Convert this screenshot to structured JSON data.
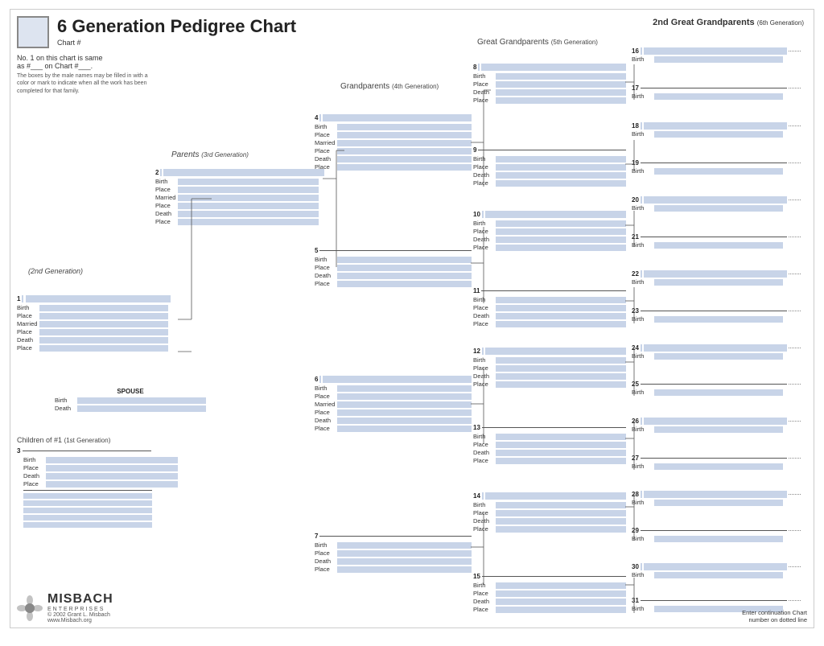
{
  "header": {
    "title": "6 Generation Pedigree Chart",
    "chart_num_label": "Chart #",
    "no1_text": "No. 1 on this chart is same",
    "no1_text2": "as #___ on Chart #___.",
    "instructions": "The boxes by the male names may be filled in with a color or mark to indicate when all the work has been completed for that family.",
    "gen2_label": "2nd Great Grandparents",
    "gen2_sub": "(6th Generation)",
    "great_label": "Great Grandparents",
    "great_sub": "(5th Generation)",
    "grand_label": "Grandparents",
    "grand_sub": "(4th Generation)",
    "parents_label": "Parents",
    "parents_sub": "(3rd Generation)",
    "gen2nd_label": "(2nd Generation)"
  },
  "fields": {
    "birth": "Birth",
    "place": "Place",
    "married": "Married",
    "death": "Death",
    "spouse": "SPOUSE",
    "children_label": "Children of #1",
    "children_sub": "(1st Generation)"
  },
  "persons": {
    "p1": {
      "num": "1"
    },
    "p2": {
      "num": "2"
    },
    "p3": {
      "num": "3"
    },
    "p4": {
      "num": "4"
    },
    "p5": {
      "num": "5"
    },
    "p6": {
      "num": "6"
    },
    "p7": {
      "num": "7"
    },
    "p8": {
      "num": "8"
    },
    "p9": {
      "num": "9"
    },
    "p10": {
      "num": "10"
    },
    "p11": {
      "num": "11"
    },
    "p12": {
      "num": "12"
    },
    "p13": {
      "num": "13"
    },
    "p14": {
      "num": "14"
    },
    "p15": {
      "num": "15"
    },
    "p16": {
      "num": "16"
    },
    "p17": {
      "num": "17"
    },
    "p18": {
      "num": "18"
    },
    "p19": {
      "num": "19"
    },
    "p20": {
      "num": "20"
    },
    "p21": {
      "num": "21"
    },
    "p22": {
      "num": "22"
    },
    "p23": {
      "num": "23"
    },
    "p24": {
      "num": "24"
    },
    "p25": {
      "num": "25"
    },
    "p26": {
      "num": "26"
    },
    "p27": {
      "num": "27"
    },
    "p28": {
      "num": "28"
    },
    "p29": {
      "num": "29"
    },
    "p30": {
      "num": "30"
    },
    "p31": {
      "num": "31"
    }
  },
  "footer": {
    "logo_line1": "MISBACH",
    "logo_line2": "ENTERPRISES",
    "copy": "© 2002 Grant L. Misbach",
    "www": "www.Misbach.org",
    "continuation": "Enter continuation Chart",
    "continuation2": "number on dotted line"
  }
}
